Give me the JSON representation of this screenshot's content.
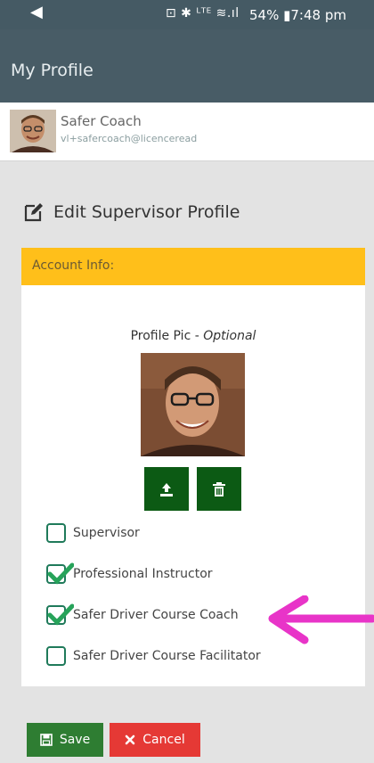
{
  "status_bar": {
    "back_glyph": "◀",
    "icons": "⊡ ✱ ᴸᵀᴱ ≋.ıl",
    "text": "54% ▮7:48 pm"
  },
  "appbar": {
    "title": "My Profile"
  },
  "user": {
    "name": "Safer Coach",
    "email": "vl+safercoach@licenceread"
  },
  "section": {
    "title": "Edit Supervisor Profile",
    "icon": "edit-icon"
  },
  "panel": {
    "header": "Account Info:",
    "pic_label": "Profile Pic - ",
    "pic_label_optional": "Optional",
    "upload_icon": "upload-icon",
    "delete_icon": "trash-icon"
  },
  "checkboxes": [
    {
      "label": "Supervisor",
      "checked": false
    },
    {
      "label": "Professional Instructor",
      "checked": true
    },
    {
      "label": "Safer Driver Course Coach",
      "checked": true
    },
    {
      "label": "Safer Driver Course Facilitator",
      "checked": false
    }
  ],
  "buttons": {
    "save": "Save",
    "cancel": "Cancel"
  },
  "colors": {
    "appbar": "#485c66",
    "panel_header": "#ffbf1a",
    "checkbox_tick": "#27a35a",
    "annotation_arrow": "#e834c8",
    "save": "#2e7d32",
    "cancel": "#e53935"
  }
}
